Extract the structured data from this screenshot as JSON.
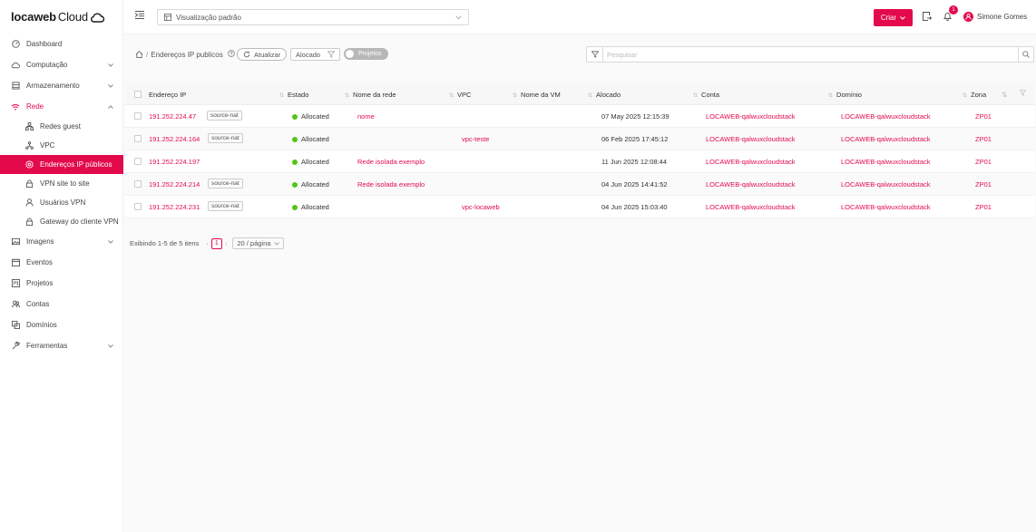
{
  "brand": {
    "name": "locaweb",
    "suffix": "Cloud"
  },
  "sidebar": {
    "items": [
      {
        "label": "Dashboard",
        "icon": "dashboard-icon"
      },
      {
        "label": "Computação",
        "icon": "cloud-icon"
      },
      {
        "label": "Armazenamento",
        "icon": "storage-icon"
      },
      {
        "label": "Rede",
        "icon": "wifi-icon"
      },
      {
        "label": "Redes guest",
        "icon": "network-icon"
      },
      {
        "label": "VPC",
        "icon": "vpc-icon"
      },
      {
        "label": "Endereços IP públicos",
        "icon": "location-icon"
      },
      {
        "label": "VPN site to site",
        "icon": "lock-icon"
      },
      {
        "label": "Usuários VPN",
        "icon": "user-icon"
      },
      {
        "label": "Gateway do cliente VPN",
        "icon": "lock-icon"
      },
      {
        "label": "Imagens",
        "icon": "image-icon"
      },
      {
        "label": "Eventos",
        "icon": "calendar-icon"
      },
      {
        "label": "Projetos",
        "icon": "project-icon"
      },
      {
        "label": "Contas",
        "icon": "team-icon"
      },
      {
        "label": "Domínios",
        "icon": "domain-icon"
      },
      {
        "label": "Ferramentas",
        "icon": "tool-icon"
      }
    ]
  },
  "topbar": {
    "view_label": "Visualização padrão",
    "create_label": "Criar",
    "notification_count": "1",
    "user_name": "Simone Gomes"
  },
  "toolbar": {
    "breadcrumb_sep": "/",
    "breadcrumb_page": "Endereços IP publicos",
    "refresh_label": "Atualizar",
    "filter_value": "Alocado",
    "projects_toggle": "Projetos",
    "search_placeholder": "Pesquisar"
  },
  "table": {
    "headers": [
      "Endereço IP",
      "Estado",
      "Nome da rede",
      "VPC",
      "Nome da VM",
      "Alocado",
      "Conta",
      "Domínio",
      "Zona"
    ],
    "rows": [
      {
        "ip": "191.252.224.47",
        "tag": "source-nat",
        "state": "Allocated",
        "network": "nome",
        "vpc": "",
        "vm": "",
        "allocated": "07 May 2025 12:15:39",
        "account": "LOCAWEB-qalwuxcloudstack",
        "domain": "LOCAWEB-qalwuxcloudstack",
        "zone": "ZP01"
      },
      {
        "ip": "191.252.224.164",
        "tag": "source-nat",
        "state": "Allocated",
        "network": "",
        "vpc": "vpc-teste",
        "vm": "",
        "allocated": "06 Feb 2025 17:45:12",
        "account": "LOCAWEB-qalwuxcloudstack",
        "domain": "LOCAWEB-qalwuxcloudstack",
        "zone": "ZP01"
      },
      {
        "ip": "191.252.224.197",
        "tag": "",
        "state": "Allocated",
        "network": "Rede isolada exemplo",
        "vpc": "",
        "vm": "",
        "allocated": "11 Jun 2025 12:08:44",
        "account": "LOCAWEB-qalwuxcloudstack",
        "domain": "LOCAWEB-qalwuxcloudstack",
        "zone": "ZP01"
      },
      {
        "ip": "191.252.224.214",
        "tag": "source-nat",
        "state": "Allocated",
        "network": "Rede isolada exemplo",
        "vpc": "",
        "vm": "",
        "allocated": "04 Jun 2025 14:41:52",
        "account": "LOCAWEB-qalwuxcloudstack",
        "domain": "LOCAWEB-qalwuxcloudstack",
        "zone": "ZP01"
      },
      {
        "ip": "191.252.224.231",
        "tag": "source-nat",
        "state": "Allocated",
        "network": "",
        "vpc": "vpc-locaweb",
        "vm": "",
        "allocated": "04 Jun 2025 15:03:40",
        "account": "LOCAWEB-qalwuxcloudstack",
        "domain": "LOCAWEB-qalwuxcloudstack",
        "zone": "ZP01"
      }
    ]
  },
  "pagination": {
    "summary": "Exibindo 1-5 de 5 itens",
    "current_page": "1",
    "page_size": "20 / página"
  },
  "colors": {
    "accent": "#e30a4b",
    "status_ok": "#52c41a"
  }
}
